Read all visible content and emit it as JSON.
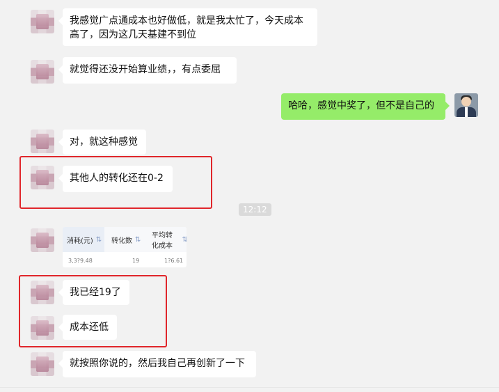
{
  "chat": {
    "messages": [
      {
        "side": "left",
        "text": "我感觉广点通成本也好做低，就是我太忙了，今天成本高了，因为这几天基建不到位"
      },
      {
        "side": "left",
        "text": "就觉得还没开始算业绩，，有点委屈"
      },
      {
        "side": "right",
        "text": "哈哈，感觉中奖了，但不是自己的"
      },
      {
        "side": "left",
        "text": "对，就这种感觉"
      },
      {
        "side": "left",
        "text": "其他人的转化还在0-2"
      },
      {
        "side": "center",
        "text": "12:12"
      },
      {
        "side": "left",
        "text": "我已经19了"
      },
      {
        "side": "left",
        "text": "成本还低"
      },
      {
        "side": "left",
        "text": "就按照你说的，然后我自己再创新了一下"
      }
    ],
    "table": {
      "headers": [
        "消耗(元)",
        "转化数",
        "平均转化成本"
      ],
      "row": [
        "3,3?9.48",
        "19",
        "1?6.61"
      ]
    }
  },
  "colors": {
    "background": "#f2f2f2",
    "left_bubble": "#ffffff",
    "right_bubble": "#95ec69",
    "highlight": "#e0262b"
  },
  "icons": {
    "left_avatar": "blurred-avatar",
    "right_avatar": "user-avatar"
  }
}
